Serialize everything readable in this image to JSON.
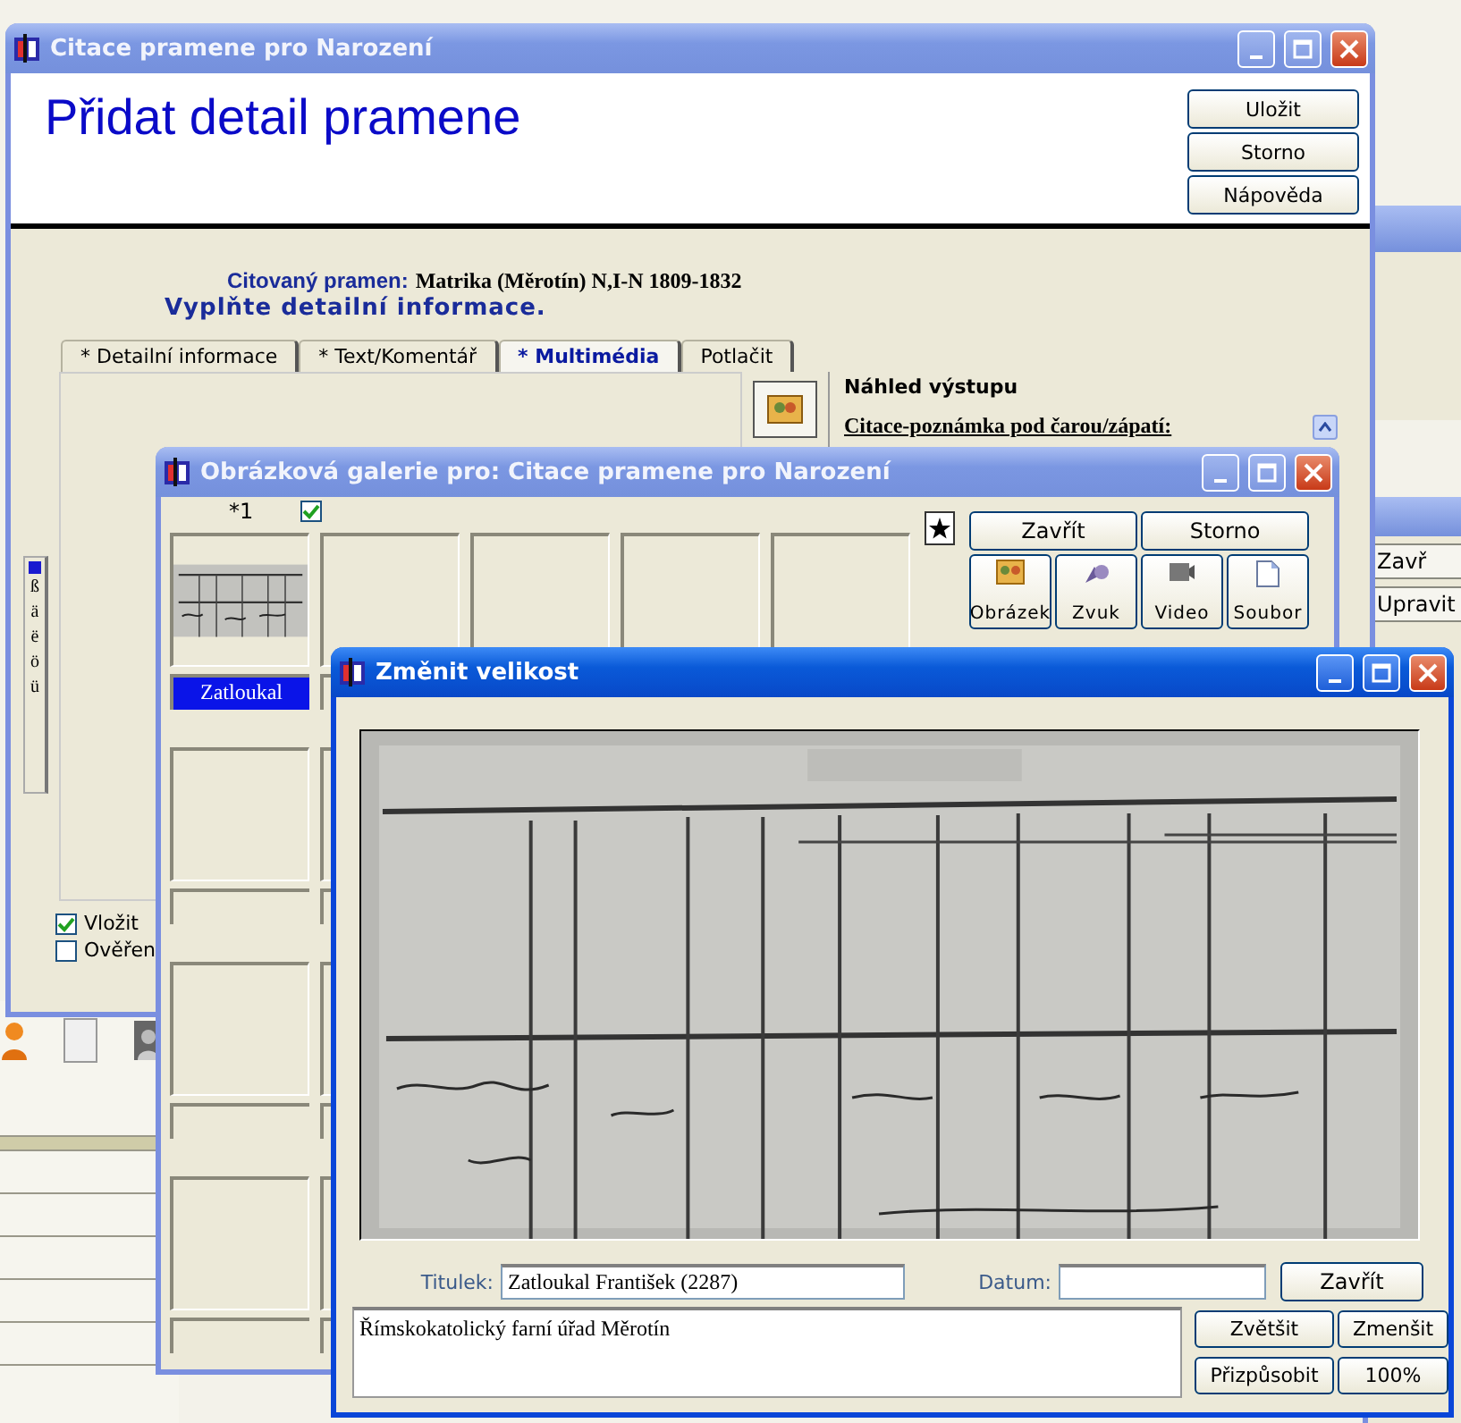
{
  "background_window": {
    "buttons": [
      "Zavř",
      "Upravit"
    ]
  },
  "main_window": {
    "title": "Citace pramene pro Narození",
    "heading": "Přidat detail pramene",
    "buttons": [
      "Uložit",
      "Storno",
      "Nápověda"
    ],
    "cited_source_label": "Citovaný pramen:",
    "cited_source": "Matrika (Měrotín) N,I-N 1809-1832",
    "instruction": "Vyplňte detailní informace.",
    "tabs": [
      {
        "label": "* Detailní informace",
        "selected": false
      },
      {
        "label": "* Text/Komentář",
        "selected": false
      },
      {
        "label": "* Multimédia",
        "selected": true
      },
      {
        "label": "Potlačit",
        "selected": false
      }
    ],
    "preview_title": "Náhled výstupu",
    "preview_subtitle": "Citace-poznámka pod čarou/zápatí:",
    "special_chars": [
      "ß",
      "ä",
      "ë",
      "ö",
      "ü"
    ],
    "checkboxes": [
      {
        "label": "Vložit",
        "checked": true
      },
      {
        "label": "Ověřen",
        "checked": false
      }
    ]
  },
  "gallery_window": {
    "title": "Obrázková galerie pro: Citace pramene pro Narození",
    "item_number": "*1",
    "item_checked": true,
    "items": [
      {
        "kind": "picture",
        "caption": "Zatloukal",
        "selected": true
      },
      {
        "kind": "empty"
      },
      {
        "kind": "empty"
      },
      {
        "kind": "empty"
      },
      {
        "kind": "empty"
      },
      {
        "kind": "empty"
      },
      {
        "kind": "empty"
      },
      {
        "kind": "empty"
      },
      {
        "kind": "empty"
      },
      {
        "kind": "empty"
      },
      {
        "kind": "empty"
      }
    ],
    "buttons": [
      "Zavřít",
      "Storno"
    ],
    "media_buttons": [
      {
        "label": "Obrázek"
      },
      {
        "kind": "sound",
        "label": "Zvuk"
      },
      {
        "kind": "video",
        "label": "Video"
      },
      {
        "kind": "file",
        "label": "Soubor"
      }
    ]
  },
  "resize_window": {
    "title": "Změnit velikost",
    "caption_label": "Titulek:",
    "caption_value": "Zatloukal František (2287)",
    "date_label": "Datum:",
    "close_button": "Zavřít",
    "note": "Římskokatolický farní úřad Měrotín",
    "buttons": [
      "Zvětšit",
      "Zmenšit",
      "Přizpůsobit",
      "100%"
    ]
  }
}
